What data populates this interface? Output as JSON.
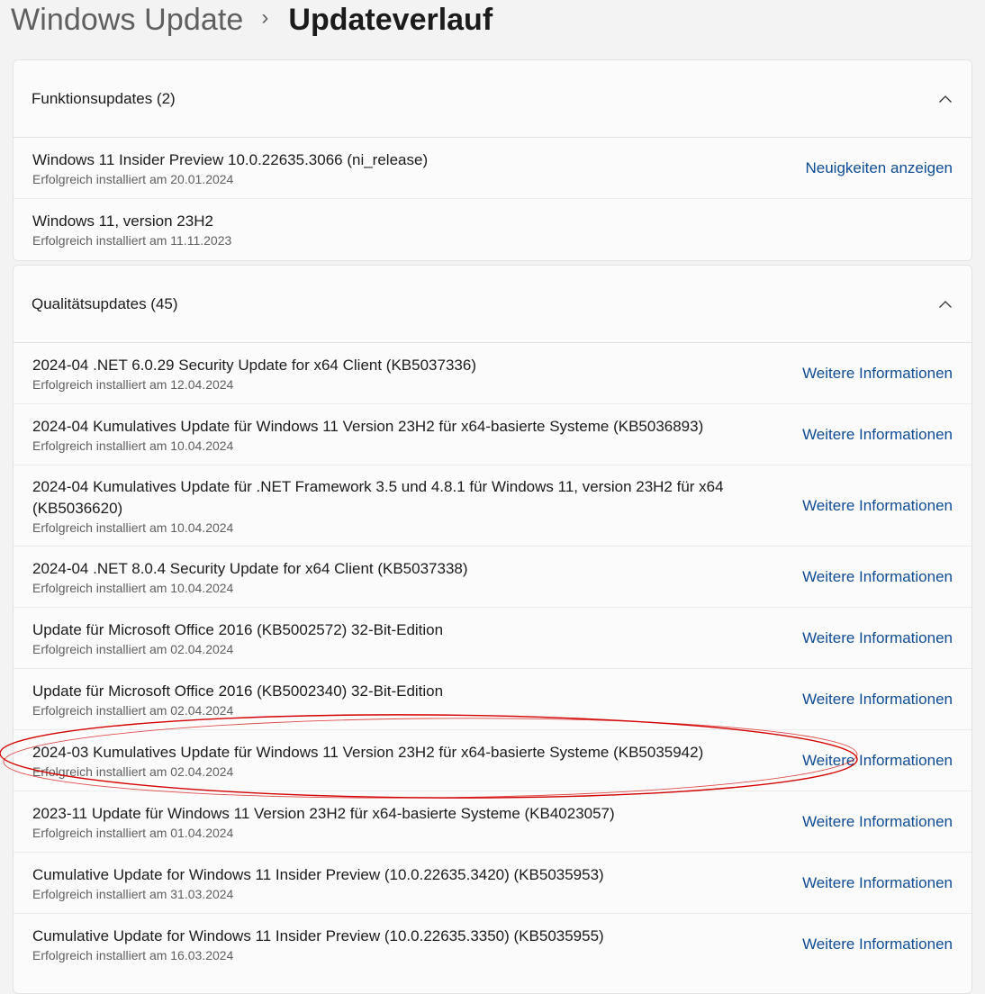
{
  "breadcrumb": {
    "parent": "Windows Update",
    "separator": "›",
    "current": "Updateverlauf"
  },
  "feature_updates": {
    "title": "Funktionsupdates (2)",
    "items": [
      {
        "name": "Windows 11 Insider Preview 10.0.22635.3066 (ni_release)",
        "status": "Erfolgreich installiert am 20.01.2024",
        "link": "Neuigkeiten anzeigen"
      },
      {
        "name": "Windows 11, version 23H2",
        "status": "Erfolgreich installiert am 11.11.2023"
      }
    ]
  },
  "quality_updates": {
    "title": "Qualitätsupdates (45)",
    "items": [
      {
        "name": "2024-04 .NET 6.0.29 Security Update for x64 Client (KB5037336)",
        "status": "Erfolgreich installiert am 12.04.2024",
        "link": "Weitere Informationen"
      },
      {
        "name": "2024-04 Kumulatives Update für Windows 11 Version 23H2 für x64-basierte Systeme (KB5036893)",
        "status": "Erfolgreich installiert am 10.04.2024",
        "link": "Weitere Informationen"
      },
      {
        "name": "2024-04 Kumulatives Update für .NET Framework 3.5 und 4.8.1 für Windows 11, version 23H2 für x64 (KB5036620)",
        "status": "Erfolgreich installiert am 10.04.2024",
        "link": "Weitere Informationen"
      },
      {
        "name": "2024-04 .NET 8.0.4 Security Update for x64 Client (KB5037338)",
        "status": "Erfolgreich installiert am 10.04.2024",
        "link": "Weitere Informationen"
      },
      {
        "name": "Update für Microsoft Office 2016 (KB5002572) 32-Bit-Edition",
        "status": "Erfolgreich installiert am 02.04.2024",
        "link": "Weitere Informationen"
      },
      {
        "name": "Update für Microsoft Office 2016 (KB5002340) 32-Bit-Edition",
        "status": "Erfolgreich installiert am 02.04.2024",
        "link": "Weitere Informationen"
      },
      {
        "name": "2024-03 Kumulatives Update für Windows 11 Version 23H2 für x64-basierte Systeme (KB5035942)",
        "status": "Erfolgreich installiert am 02.04.2024",
        "link": "Weitere Informationen"
      },
      {
        "name": "2023-11 Update für Windows 11 Version 23H2 für x64-basierte Systeme (KB4023057)",
        "status": "Erfolgreich installiert am 01.04.2024",
        "link": "Weitere Informationen"
      },
      {
        "name": "Cumulative Update for Windows 11 Insider Preview (10.0.22635.3420) (KB5035953)",
        "status": "Erfolgreich installiert am 31.03.2024",
        "link": "Weitere Informationen"
      },
      {
        "name": "Cumulative Update for Windows 11 Insider Preview (10.0.22635.3350) (KB5035955)",
        "status": "Erfolgreich installiert am 16.03.2024",
        "link": "Weitere Informationen"
      }
    ]
  },
  "icons": {
    "collapse": "chevron-up-icon",
    "breadcrumb_separator": "chevron-right-icon"
  },
  "colors": {
    "link": "#0f4c94",
    "highlight_ellipse": "#d40000"
  }
}
